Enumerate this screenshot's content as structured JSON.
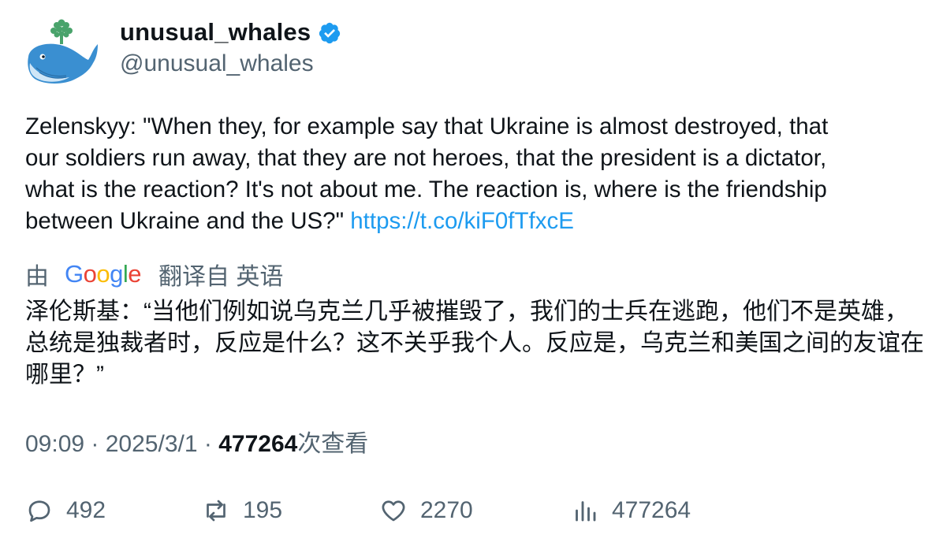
{
  "author": {
    "display_name": "unusual_whales",
    "handle": "@unusual_whales",
    "verified": true
  },
  "tweet": {
    "text": "Zelenskyy: \"When they, for example say that Ukraine is almost destroyed, that\nour soldiers run away, that they are not heroes, that the president is a dictator,\nwhat is the reaction? It's not about me. The reaction is, where is the friendship\nbetween Ukraine and the US?\" ",
    "link": "https://t.co/kiF0fTfxcE"
  },
  "translation": {
    "prefix": "由",
    "provider": "Google",
    "suffix": "翻译自 英语",
    "text": "泽伦斯基：“当他们例如说乌克兰几乎被摧毁了，我们的士兵在逃跑，他们不是英雄，总统是独裁者时，反应是什么？这不关乎我个人。反应是，乌克兰和美国之间的友谊在哪里？”"
  },
  "meta": {
    "time": "09:09",
    "date": "2025/3/1",
    "views": "477264",
    "views_label": "次查看"
  },
  "actions": {
    "replies": "492",
    "retweets": "195",
    "likes": "2270",
    "views": "477264"
  },
  "colors": {
    "link": "#1d9bf0",
    "secondary_text": "#536471",
    "primary_text": "#0f1419",
    "verified_badge": "#1d9bf0"
  }
}
